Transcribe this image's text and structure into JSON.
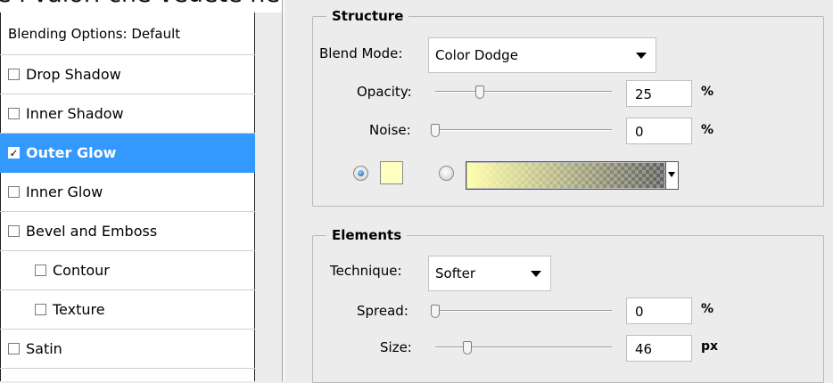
{
  "top_caption": "e i valori che vedete nell'immagine.",
  "left_panel": {
    "header": "Blending Options: Default",
    "items": [
      {
        "label": "Drop Shadow",
        "checked": false,
        "selected": false,
        "indent": false
      },
      {
        "label": "Inner Shadow",
        "checked": false,
        "selected": false,
        "indent": false
      },
      {
        "label": "Outer Glow",
        "checked": true,
        "selected": true,
        "indent": false
      },
      {
        "label": "Inner Glow",
        "checked": false,
        "selected": false,
        "indent": false
      },
      {
        "label": "Bevel and Emboss",
        "checked": false,
        "selected": false,
        "indent": false
      },
      {
        "label": "Contour",
        "checked": false,
        "selected": false,
        "indent": true
      },
      {
        "label": "Texture",
        "checked": false,
        "selected": false,
        "indent": true
      },
      {
        "label": "Satin",
        "checked": false,
        "selected": false,
        "indent": false
      }
    ],
    "check_glyph": "✓"
  },
  "structure": {
    "title": "Structure",
    "blend_mode_label": "Blend Mode:",
    "blend_mode_value": "Color Dodge",
    "opacity_label": "Opacity:",
    "opacity_value": "25",
    "opacity_unit": "%",
    "opacity_slider_fraction": 0.25,
    "noise_label": "Noise:",
    "noise_value": "0",
    "noise_unit": "%",
    "noise_slider_fraction": 0,
    "color_mode": "solid",
    "solid_color": "#ffffc0",
    "gradient_color": "#ffffaf"
  },
  "elements": {
    "title": "Elements",
    "technique_label": "Technique:",
    "technique_value": "Softer",
    "spread_label": "Spread:",
    "spread_value": "0",
    "spread_unit": "%",
    "spread_slider_fraction": 0,
    "size_label": "Size:",
    "size_value": "46",
    "size_unit": "px",
    "size_slider_fraction": 0.18
  },
  "colors": {
    "selection": "#3399ff",
    "panel_bg": "#ececec"
  }
}
